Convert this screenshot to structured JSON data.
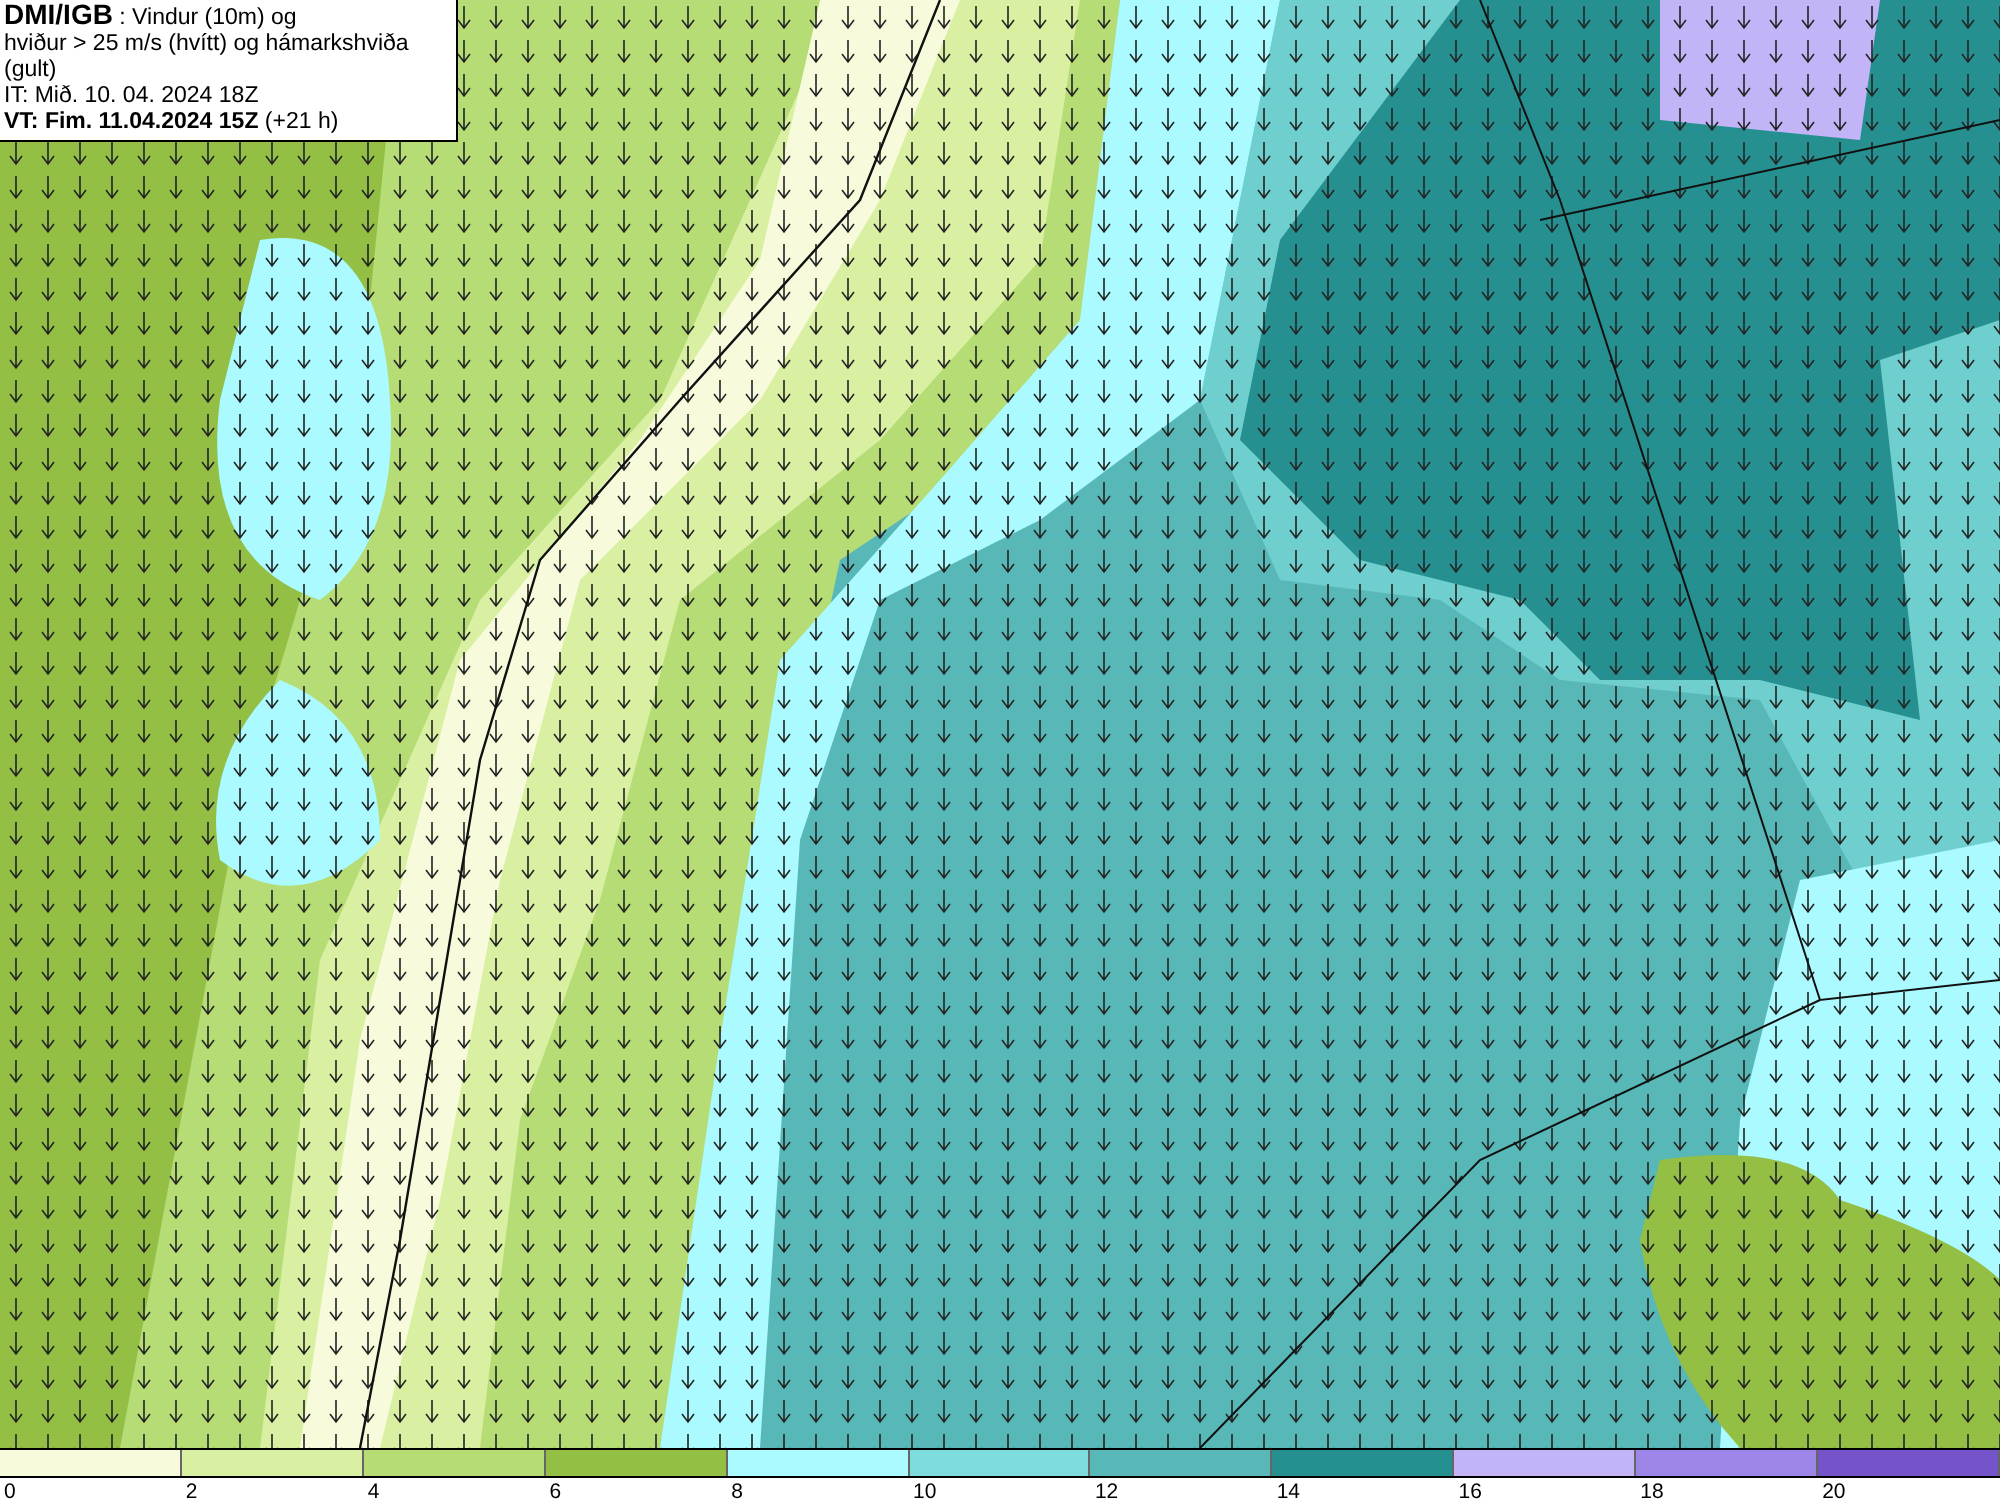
{
  "header": {
    "source": "DMI/IGB",
    "title": ": Vindur (10m) og",
    "subtitle": "hviður > 25 m/s (hvítt) og hámarkshviða (gult)",
    "initial_time": "IT: Mið. 10. 04. 2024 18Z",
    "valid_time": "VT: Fim. 11.04.2024 15Z",
    "lead": "(+21 h)"
  },
  "legend": {
    "swatches": [
      {
        "color": "#f7fbdc"
      },
      {
        "color": "#d9f0a3"
      },
      {
        "color": "#b5dc75"
      },
      {
        "color": "#93bf45"
      },
      {
        "color": "#aafaff"
      },
      {
        "color": "#7fdcdc"
      },
      {
        "color": "#58b8b8"
      },
      {
        "color": "#269090"
      },
      {
        "color": "#c3b4f8"
      },
      {
        "color": "#9d86e8"
      },
      {
        "color": "#7454c8"
      }
    ],
    "labels": [
      "0",
      "2",
      "4",
      "6",
      "8",
      "10",
      "12",
      "14",
      "16",
      "18",
      "20"
    ]
  }
}
